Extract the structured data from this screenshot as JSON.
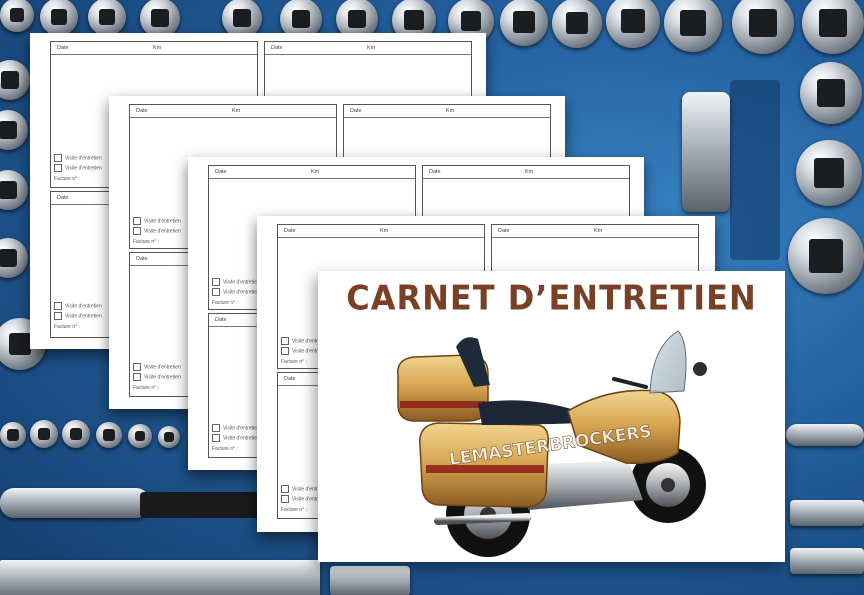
{
  "cover": {
    "title": "CARNET D’ENTRETIEN",
    "watermark": "LEMASTERBROCKERS",
    "title_color": "#7a4026",
    "bike_color": "#d4a24e"
  },
  "form_labels": {
    "date": "Date",
    "km": "Km",
    "visit": "Visite d'entretien",
    "invoice": "Facture n° :"
  },
  "background": {
    "description_icon": "socket-wrench-set"
  }
}
